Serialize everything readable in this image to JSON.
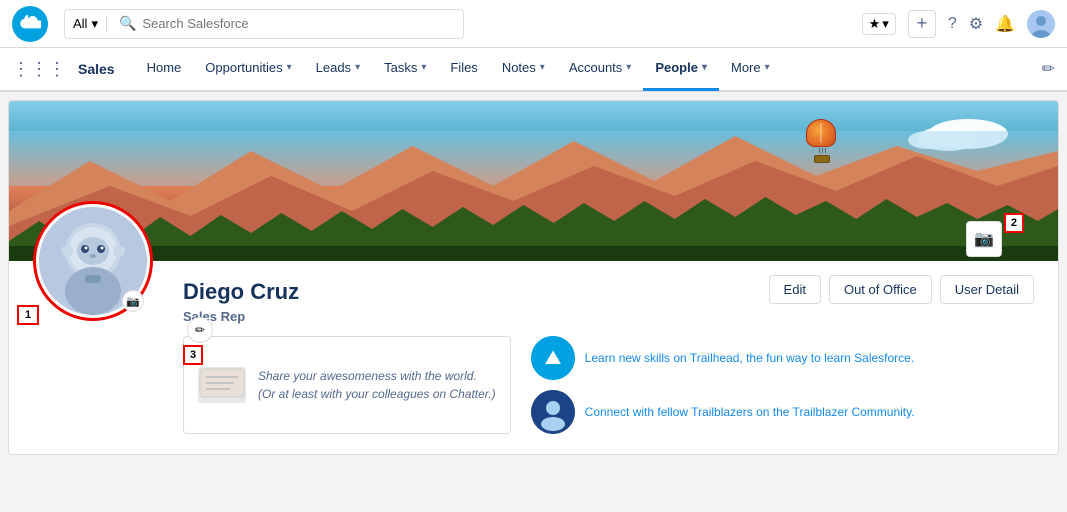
{
  "utility_bar": {
    "search_placeholder": "Search Salesforce",
    "search_all_label": "All",
    "star_icon": "★",
    "chevron_down": "▾",
    "add_icon": "+",
    "help_icon": "?",
    "settings_icon": "⚙",
    "bell_icon": "🔔"
  },
  "nav": {
    "app_name": "Sales",
    "items": [
      {
        "label": "Home",
        "has_dropdown": false
      },
      {
        "label": "Opportunities",
        "has_dropdown": true
      },
      {
        "label": "Leads",
        "has_dropdown": true
      },
      {
        "label": "Tasks",
        "has_dropdown": true
      },
      {
        "label": "Files",
        "has_dropdown": false
      },
      {
        "label": "Notes",
        "has_dropdown": true
      },
      {
        "label": "Accounts",
        "has_dropdown": true
      },
      {
        "label": "People",
        "has_dropdown": true,
        "active": true
      },
      {
        "label": "More",
        "has_dropdown": true
      }
    ]
  },
  "profile": {
    "name": "Diego Cruz",
    "title": "Sales Rep",
    "actions": {
      "edit": "Edit",
      "out_of_office": "Out of Office",
      "user_detail": "User Detail"
    },
    "chatter": {
      "text": "Share your awesomeness with the world.\n(Or at least with your colleagues on Chatter.)"
    },
    "trailhead": {
      "link1": "Learn new skills on Trailhead, the fun way to learn Salesforce.",
      "link2": "Connect with fellow Trailblazers on the Trailblazer Community."
    }
  },
  "labels": {
    "badge1": "1",
    "badge2": "2",
    "badge3": "3"
  }
}
